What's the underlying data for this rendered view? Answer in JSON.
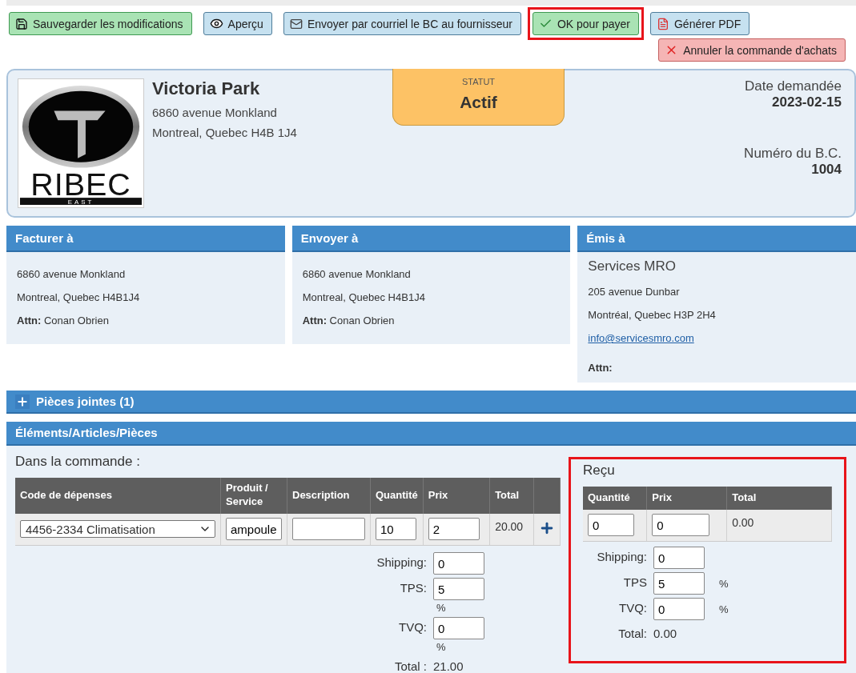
{
  "toolbar": {
    "buttons": [
      {
        "label": "Sauvegarder les modifications",
        "kind": "save",
        "highlighted": false
      },
      {
        "label": "Aperçu",
        "kind": "preview",
        "highlighted": false
      },
      {
        "label": "Envoyer par courriel le BC au fournisseur",
        "kind": "email",
        "highlighted": false
      },
      {
        "label": "OK pour payer",
        "kind": "approve",
        "highlighted": true
      },
      {
        "label": "Générer PDF",
        "kind": "pdf",
        "highlighted": false
      }
    ],
    "second_row": [
      {
        "label": "Annuler la commande d'achats",
        "kind": "cancel",
        "highlighted": false
      }
    ]
  },
  "header": {
    "logo": {
      "text": "RIBEC",
      "subtext": "EAST"
    },
    "company": "Victoria Park",
    "address_lines": [
      "6860 avenue Monkland",
      "Montreal, Quebec H4B 1J4"
    ],
    "status": {
      "label": "STATUT",
      "value": "Actif"
    },
    "date_label": "Date demandée",
    "date": "2023-02-15",
    "number_label": "Numéro du B.C.",
    "number": "1004"
  },
  "addresses": [
    {
      "title": "Facturer à",
      "lines": [
        "6860 avenue Monkland",
        "Montreal, Quebec H4B1J4"
      ],
      "attn_label": "Attn:",
      "attn": "Conan Obrien"
    },
    {
      "title": "Envoyer à",
      "lines": [
        "6860 avenue Monkland",
        "Montreal, Quebec H4B1J4"
      ],
      "attn_label": "Attn:",
      "attn": "Conan Obrien"
    },
    {
      "title": "Émis à",
      "name": "Services MRO",
      "lines": [
        "205 avenue Dunbar",
        "Montréal, Quebec H3P 2H4"
      ],
      "email": "info@servicesmro.com",
      "attn_label": "Attn:"
    }
  ],
  "attachments": {
    "title": "Pièces jointes (1)",
    "expanded": false
  },
  "items": {
    "title": "Éléments/Articles/Pièces",
    "order": {
      "heading": "Dans la commande :",
      "columns": [
        "Code de dépenses",
        "Produit / Service",
        "Description",
        "Quantité",
        "Prix",
        "Total"
      ],
      "rows": [
        {
          "expense_code": "4456-2334 Climatisation",
          "product": "ampoule",
          "description": "",
          "quantity": "10",
          "price": "2",
          "total": "20.00"
        }
      ],
      "totals": [
        {
          "label": "Shipping:",
          "value": "0"
        },
        {
          "label": "TPS:",
          "value": "5",
          "unit": "%"
        },
        {
          "label": "TVQ:",
          "value": "0",
          "unit": "%"
        }
      ],
      "total_label": "Total :",
      "total": "21.00"
    },
    "received": {
      "heading": "Reçu",
      "highlighted": true,
      "columns": [
        "Quantité",
        "Prix",
        "Total"
      ],
      "rows": [
        {
          "quantity": "0",
          "price": "0",
          "total": "0.00"
        }
      ],
      "totals": [
        {
          "label": "Shipping:",
          "value": "0"
        },
        {
          "label": "TPS",
          "value": "5",
          "unit": "%"
        },
        {
          "label": "TVQ:",
          "value": "0",
          "unit": "%"
        }
      ],
      "total_label": "Total:",
      "total": "0.00"
    }
  }
}
